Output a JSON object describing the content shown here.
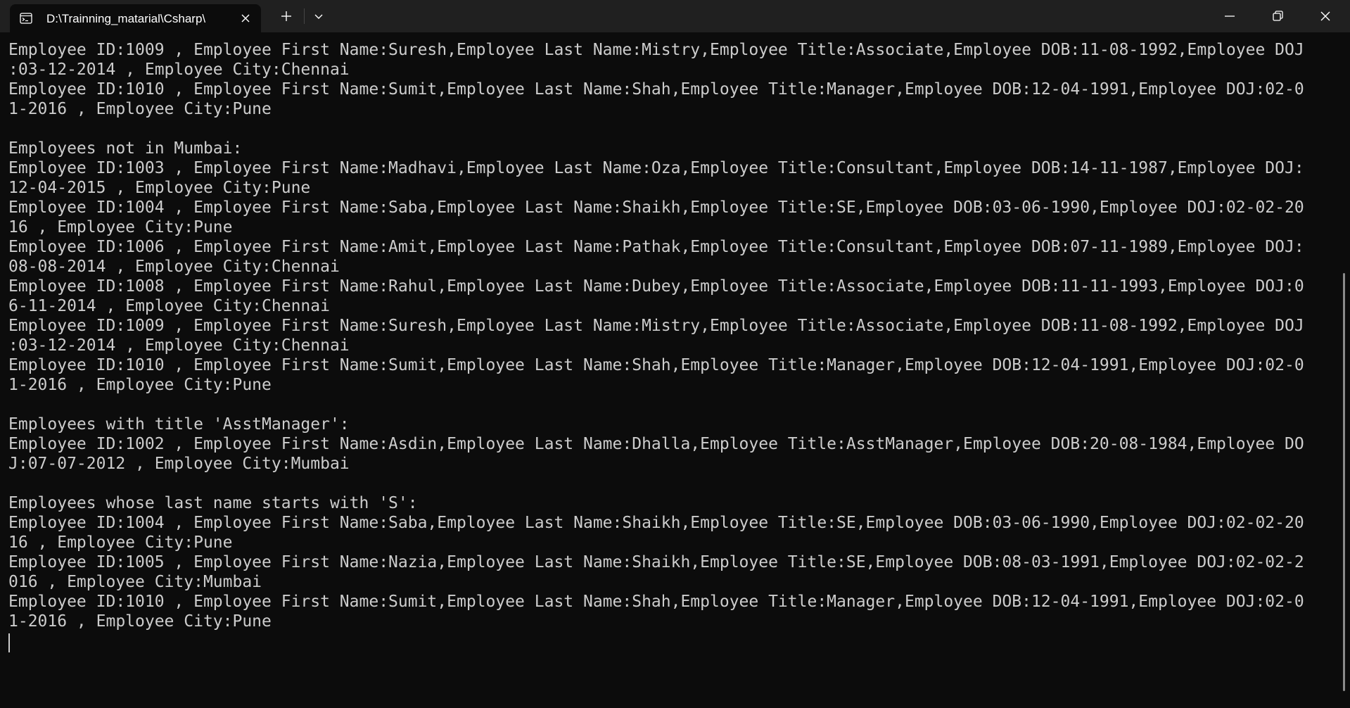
{
  "titlebar": {
    "tab_title": "D:\\Trainning_matarial\\Csharp\\"
  },
  "terminal": {
    "text": "Employee ID:1009 , Employee First Name:Suresh,Employee Last Name:Mistry,Employee Title:Associate,Employee DOB:11-08-1992,Employee DOJ\n:03-12-2014 , Employee City:Chennai\nEmployee ID:1010 , Employee First Name:Sumit,Employee Last Name:Shah,Employee Title:Manager,Employee DOB:12-04-1991,Employee DOJ:02-0\n1-2016 , Employee City:Pune\n\nEmployees not in Mumbai:\nEmployee ID:1003 , Employee First Name:Madhavi,Employee Last Name:Oza,Employee Title:Consultant,Employee DOB:14-11-1987,Employee DOJ:\n12-04-2015 , Employee City:Pune\nEmployee ID:1004 , Employee First Name:Saba,Employee Last Name:Shaikh,Employee Title:SE,Employee DOB:03-06-1990,Employee DOJ:02-02-20\n16 , Employee City:Pune\nEmployee ID:1006 , Employee First Name:Amit,Employee Last Name:Pathak,Employee Title:Consultant,Employee DOB:07-11-1989,Employee DOJ:\n08-08-2014 , Employee City:Chennai\nEmployee ID:1008 , Employee First Name:Rahul,Employee Last Name:Dubey,Employee Title:Associate,Employee DOB:11-11-1993,Employee DOJ:0\n6-11-2014 , Employee City:Chennai\nEmployee ID:1009 , Employee First Name:Suresh,Employee Last Name:Mistry,Employee Title:Associate,Employee DOB:11-08-1992,Employee DOJ\n:03-12-2014 , Employee City:Chennai\nEmployee ID:1010 , Employee First Name:Sumit,Employee Last Name:Shah,Employee Title:Manager,Employee DOB:12-04-1991,Employee DOJ:02-0\n1-2016 , Employee City:Pune\n\nEmployees with title 'AsstManager':\nEmployee ID:1002 , Employee First Name:Asdin,Employee Last Name:Dhalla,Employee Title:AsstManager,Employee DOB:20-08-1984,Employee DO\nJ:07-07-2012 , Employee City:Mumbai\n\nEmployees whose last name starts with 'S':\nEmployee ID:1004 , Employee First Name:Saba,Employee Last Name:Shaikh,Employee Title:SE,Employee DOB:03-06-1990,Employee DOJ:02-02-20\n16 , Employee City:Pune\nEmployee ID:1005 , Employee First Name:Nazia,Employee Last Name:Shaikh,Employee Title:SE,Employee DOB:08-03-1991,Employee DOJ:02-02-2\n016 , Employee City:Mumbai\nEmployee ID:1010 , Employee First Name:Sumit,Employee Last Name:Shah,Employee Title:Manager,Employee DOB:12-04-1991,Employee DOJ:02-0\n1-2016 , Employee City:Pune"
  },
  "icons": {
    "tab": "terminal-icon",
    "close_tab": "close-icon",
    "new_tab": "plus-icon",
    "dropdown": "chevron-down-icon",
    "minimize": "minimize-icon",
    "maximize": "restore-icon",
    "close_window": "close-icon"
  },
  "colors": {
    "background": "#0c0c0c",
    "titlebar": "#202020",
    "text": "#cccccc",
    "icon": "#ffffff"
  }
}
